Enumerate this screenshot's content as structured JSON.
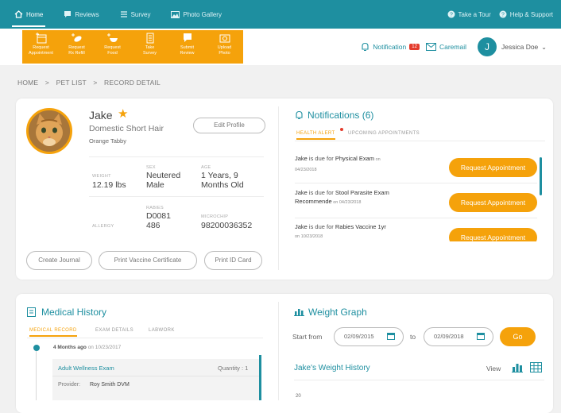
{
  "nav": {
    "items": [
      {
        "label": "Home"
      },
      {
        "label": "Reviews"
      },
      {
        "label": "Survey"
      },
      {
        "label": "Photo Gallery"
      }
    ],
    "tour": "Take a Tour",
    "help": "Help & Support"
  },
  "quick_actions": [
    {
      "line1": "Request",
      "line2": "Appointment"
    },
    {
      "line1": "Request",
      "line2": "Rx Refill"
    },
    {
      "line1": "Request",
      "line2": "Food"
    },
    {
      "line1": "Take",
      "line2": "Survey"
    },
    {
      "line1": "Submit",
      "line2": "Review"
    },
    {
      "line1": "Upload",
      "line2": "Photo"
    }
  ],
  "user": {
    "notification_label": "Notification",
    "notification_count": "12",
    "caremail_label": "Caremail",
    "avatar_initial": "J",
    "name": "Jessica Doe"
  },
  "breadcrumb": {
    "home": "HOME",
    "sep1": ">",
    "petlist": "PET LIST",
    "sep2": ">",
    "current": "RECORD DETAIL"
  },
  "pet": {
    "name": "Jake",
    "breed": "Domestic Short Hair",
    "color": "Orange Tabby",
    "edit_label": "Edit Profile",
    "weight_label": "WEIGHT",
    "weight": "12.19 lbs",
    "sex_label": "SEX",
    "sex_line1": "Neutered",
    "sex_line2": "Male",
    "age_label": "AGE",
    "age_line1": "1 Years, 9",
    "age_line2": "Months Old",
    "allergy_label": "ALLERGY",
    "rabies_label": "RABIES",
    "rabies_line1": "D0081",
    "rabies_line2": "486",
    "microchip_label": "MICROCHIP",
    "microchip": "98200036352"
  },
  "pet_actions": {
    "journal": "Create Journal",
    "vaccine": "Print Vaccine Certificate",
    "idcard": "Print ID Card"
  },
  "notifications": {
    "title": "Notifications (6)",
    "tab_health": "HEALTH ALERT",
    "tab_upcoming": "UPCOMING APPOINTMENTS",
    "rows": [
      {
        "pet": "Jake",
        "mid": " is due for ",
        "item": "Physical Exam",
        "on": " on",
        "date": "04/23/2018",
        "button": "Request Appointment"
      },
      {
        "pet": "Jake",
        "mid": " is due for ",
        "item": "Stool Parasite Exam",
        "item2": "Recommende",
        "on": " on 04/23/2018",
        "date": "",
        "button": "Request Appointment"
      },
      {
        "pet": "Jake",
        "mid": " is due for ",
        "item": "Rabies Vaccine 1yr",
        "on": "",
        "date": "on 10/23/2018",
        "button": "Request Appointment"
      }
    ]
  },
  "medical": {
    "title": "Medical History",
    "tab_record": "MEDICAL RECORD",
    "tab_exam": "EXAM DETAILS",
    "tab_lab": "LABWORK",
    "entry_ago": "4 Months ago",
    "entry_date": " on 10/23/2017",
    "visit": "Adult Wellness Exam",
    "quantity": "Quantity : 1",
    "provider_label": "Provider:",
    "provider": "Roy Smith DVM"
  },
  "weight_graph": {
    "title": "Weight Graph",
    "start_label": "Start from",
    "start_date": "02/09/2015",
    "to_label": "to",
    "end_date": "02/09/2018",
    "go": "Go",
    "history_title": "Jake's Weight History",
    "view_label": "View",
    "y_tick": "20"
  },
  "colors": {
    "teal": "#1e8fa0",
    "orange": "#f5a20b",
    "red": "#e43b2c"
  }
}
